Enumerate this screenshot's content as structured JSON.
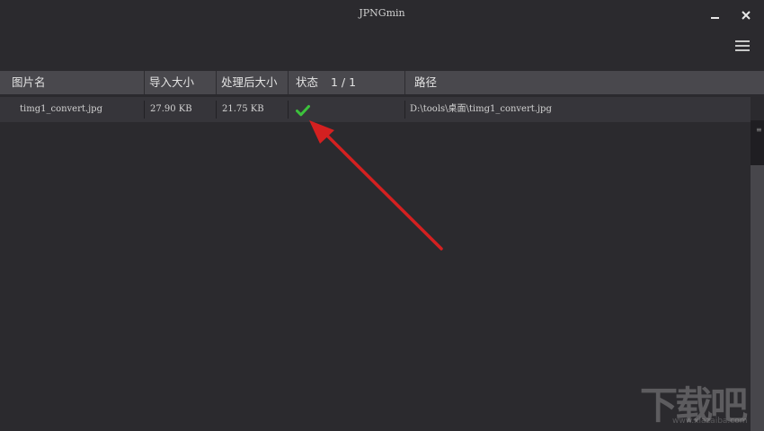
{
  "window": {
    "title": "JPNGmin",
    "minimize_icon": "minimize-icon",
    "close_icon": "close-icon",
    "menu_icon": "hamburger-menu-icon"
  },
  "table": {
    "columns": {
      "name": "图片名",
      "import_size": "导入大小",
      "processed_size": "处理后大小",
      "status": "状态",
      "count": "1 / 1",
      "path": "路径"
    },
    "rows": [
      {
        "name": "timg1_convert.jpg",
        "import_size": "27.90 KB",
        "processed_size": "21.75 KB",
        "status_icon": "success-check-icon",
        "path": "D:\\tools\\桌面\\timg1_convert.jpg"
      }
    ]
  },
  "colors": {
    "background": "#2b2a2e",
    "header": "#49484d",
    "row": "#36353a",
    "success": "#3cc23c",
    "annotation_arrow": "#d42020"
  },
  "watermark": {
    "text": "下载吧",
    "sub": "www.xiazaiba.com"
  }
}
